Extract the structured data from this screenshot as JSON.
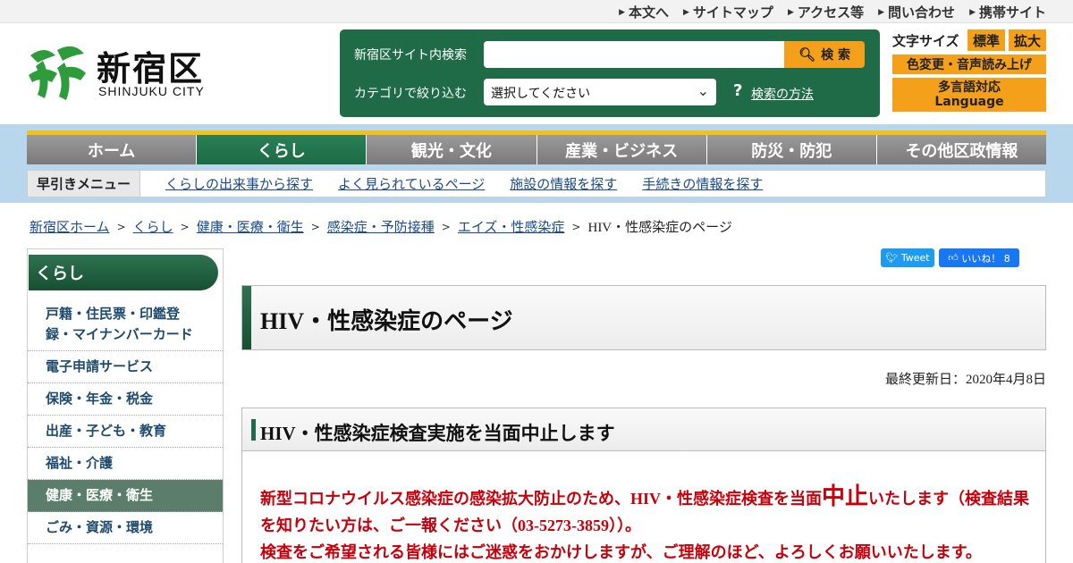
{
  "topbar": {
    "items": [
      "本文へ",
      "サイトマップ",
      "アクセス等",
      "問い合わせ",
      "携帯サイト"
    ]
  },
  "header": {
    "logo_name": "新宿区",
    "logo_sub": "SHINJUKU CITY",
    "search_label": "新宿区サイト内検索",
    "search_value": "",
    "search_button": "検 索",
    "category_label": "カテゴリで絞り込む",
    "category_selected": "選択してください",
    "help_mark": "?",
    "help_link": "検索の方法",
    "font_size_label": "文字サイズ",
    "font_standard": "標準",
    "font_large": "拡大",
    "color_voice": "色変更・音声読み上げ",
    "lang_line1": "多言語対応",
    "lang_line2": "Language"
  },
  "gnav": {
    "items": [
      "ホーム",
      "くらし",
      "観光・文化",
      "産業・ビジネス",
      "防災・防犯",
      "その他区政情報"
    ]
  },
  "quickmenu": {
    "label": "早引きメニュー",
    "links": [
      "くらしの出来事から探す",
      "よく見られているページ",
      "施設の情報を探す",
      "手続きの情報を探す"
    ]
  },
  "breadcrumb": {
    "links": [
      "新宿区ホーム",
      "くらし",
      "健康・医療・衛生",
      "感染症・予防接種",
      "エイズ・性感染症"
    ],
    "separator": ">",
    "current": "HIV・性感染症のページ"
  },
  "sidebar": {
    "title": "くらし",
    "items": [
      {
        "line1": "戸籍・住民票・印鑑登",
        "line2": "録・マイナンバーカード"
      },
      {
        "line1": "電子申請サービス"
      },
      {
        "line1": "保険・年金・税金"
      },
      {
        "line1": "出産・子ども・教育"
      },
      {
        "line1": "福祉・介護"
      },
      {
        "line1": "健康・医療・衛生"
      },
      {
        "line1": "ごみ・資源・環境"
      }
    ]
  },
  "social": {
    "tweet": "Tweet",
    "like": "いいね！ 8"
  },
  "main": {
    "page_title": "HIV・性感染症のページ",
    "updated": "最終更新日：2020年4月8日",
    "section_title": "HIV・性感染症検査実施を当面中止します",
    "notice_part1": "新型コロナウイルス感染症の感染拡大防止のため、HIV・性感染症検査を当面",
    "notice_big": "中止",
    "notice_part2": "いたします（検査結果を知りたい方は、ご一報ください（03-5273-3859））。",
    "notice_line2": "検査をご希望される皆様にはご迷惑をおかけしますが、ご理解のほど、よろしくお願いいたします。"
  },
  "colors": {
    "brand_green": "#1f6b47",
    "accent_orange": "#f5a01a",
    "nav_band": "#b8d7ec",
    "notice_red": "#c8000b"
  }
}
